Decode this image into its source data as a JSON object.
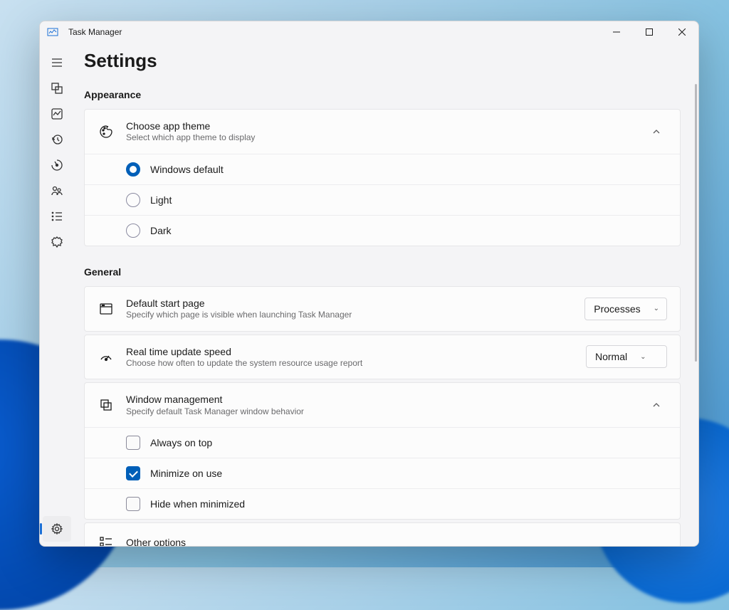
{
  "window": {
    "title": "Task Manager"
  },
  "page": {
    "title": "Settings"
  },
  "sections": {
    "appearance": {
      "header": "Appearance",
      "theme": {
        "title": "Choose app theme",
        "subtitle": "Select which app theme to display",
        "options": [
          "Windows default",
          "Light",
          "Dark"
        ],
        "selected": "Windows default"
      }
    },
    "general": {
      "header": "General",
      "start_page": {
        "title": "Default start page",
        "subtitle": "Specify which page is visible when launching Task Manager",
        "value": "Processes"
      },
      "update_speed": {
        "title": "Real time update speed",
        "subtitle": "Choose how often to update the system resource usage report",
        "value": "Normal"
      },
      "window_mgmt": {
        "title": "Window management",
        "subtitle": "Specify default Task Manager window behavior",
        "options": {
          "always_on_top": {
            "label": "Always on top",
            "checked": false
          },
          "minimize_on_use": {
            "label": "Minimize on use",
            "checked": true
          },
          "hide_when_minimized": {
            "label": "Hide when minimized",
            "checked": false
          }
        }
      },
      "other": {
        "title": "Other options"
      }
    }
  }
}
